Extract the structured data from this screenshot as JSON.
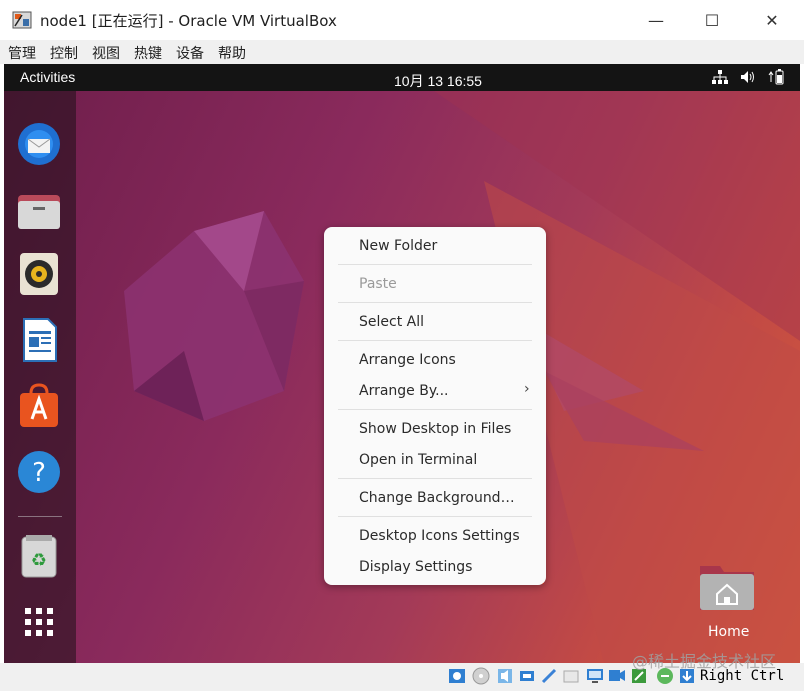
{
  "window": {
    "title": "node1 [正在运行] - Oracle VM VirtualBox",
    "minimize_glyph": "—",
    "maximize_glyph": "☐",
    "close_glyph": "✕"
  },
  "menubar": [
    "管理",
    "控制",
    "视图",
    "热键",
    "设备",
    "帮助"
  ],
  "topbar": {
    "activities": "Activities",
    "clock": "10月 13  16:55",
    "tray_icons": [
      "network-icon",
      "volume-icon",
      "battery-icon"
    ]
  },
  "dock": {
    "items": [
      "thunderbird-icon",
      "files-icon",
      "rhythmbox-icon",
      "writer-icon",
      "software-icon",
      "help-icon",
      "trash-icon",
      "apps-grid-icon"
    ]
  },
  "context_menu": {
    "new_folder": "New Folder",
    "paste": "Paste",
    "select_all": "Select All",
    "arrange_icons": "Arrange Icons",
    "arrange_by": "Arrange By...",
    "show_desktop": "Show Desktop in Files",
    "open_terminal": "Open in Terminal",
    "change_background": "Change Background…",
    "desktop_icons_settings": "Desktop Icons Settings",
    "display_settings": "Display Settings",
    "submenu_arrow": "›"
  },
  "desktop": {
    "home_label": "Home"
  },
  "statusbar": {
    "host_key": "Right Ctrl",
    "watermark": "@稀土掘金技术社区"
  },
  "colors": {
    "highlight_border": "#e03c2c",
    "topbar": "#141414"
  }
}
